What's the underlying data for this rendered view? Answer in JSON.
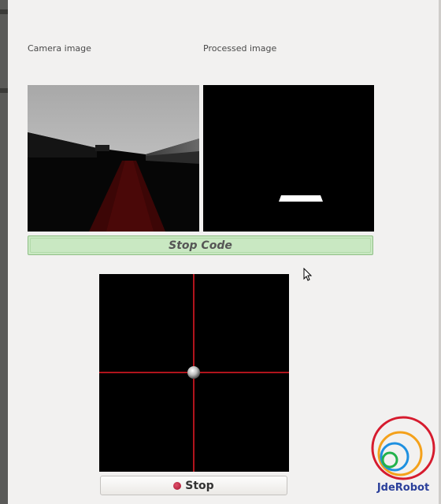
{
  "labels": {
    "camera": "Camera image",
    "processed": "Processed image"
  },
  "buttons": {
    "stop_code": "Stop Code",
    "stop": "Stop"
  },
  "logo": {
    "text": "JdeRobot"
  },
  "colors": {
    "stop_code_bg": "#c9e8c2",
    "crosshair": "#b0141c",
    "stop_icon": "#c21a3a",
    "logo_red": "#d61b2e",
    "logo_orange": "#f4a11b",
    "logo_blue": "#1e90e0",
    "logo_green": "#22b24c",
    "logo_text": "#2a3f9a"
  },
  "icons": {
    "stop": "record-icon",
    "cursor": "mouse-cursor-icon"
  }
}
